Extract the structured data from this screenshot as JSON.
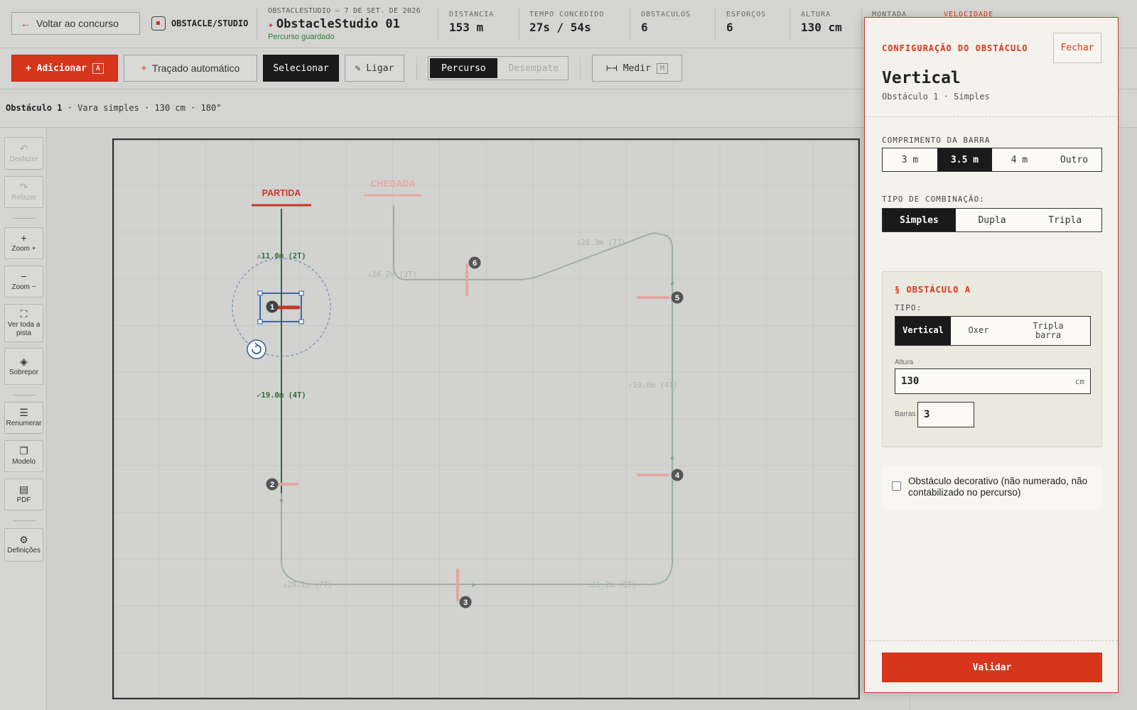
{
  "topbar": {
    "back_label": "Voltar ao concurso",
    "brand": "OBSTACLE/STUDIO",
    "doc_subtitle": "OBSTACLESTUDIO — 7 DE SET. DE 2026",
    "doc_title": "ObstacleStudio 01",
    "saved_status": "Percurso guardado",
    "stats": [
      {
        "label": "DISTANCIA",
        "value": "153 m"
      },
      {
        "label": "TEMPO CONCEDIDO",
        "value": "27s / 54s"
      },
      {
        "label": "OBSTACULOS",
        "value": "6"
      },
      {
        "label": "ESFORÇOS",
        "value": "6"
      },
      {
        "label": "ALTURA",
        "value": "130 cm"
      },
      {
        "label": "MONTADA",
        "value": ""
      },
      {
        "label": "VELOCIDADE",
        "value": ""
      }
    ]
  },
  "toolbar": {
    "add_label": "+ Adicionar",
    "add_key": "A",
    "auto_label": "Traçado automático",
    "select_label": "Selecionar",
    "link_label": "✎ Ligar",
    "mode_tabs": [
      "Percurso",
      "Desempate"
    ],
    "measure_label": "Medir",
    "measure_key": "M"
  },
  "inforow": {
    "obstacle": "Obstáculo 1",
    "details": " · Vara simples · 130 cm · 180°"
  },
  "sidebar": {
    "undo": "Desfazer",
    "redo": "Refazer",
    "zoom_in": "Zoom +",
    "zoom_out": "Zoom −",
    "fit": "Ver toda a pista",
    "overlay": "Sobrepor",
    "renumber": "Renumerar",
    "template": "Modelo",
    "pdf": "PDF",
    "settings": "Definições"
  },
  "course": {
    "start_label": "PARTIDA",
    "finish_label": "CHEGADA",
    "segments": [
      "⚠11.0m (2T)",
      "✓19.0m (4T)",
      "⚠28.2m (7T)",
      "⚠31.2m (8T)",
      "✓19.0m (4T)",
      "⚠28.3m (7T)",
      "⚠16.2m (3T)"
    ],
    "obstacle_numbers": [
      "1",
      "2",
      "3",
      "4",
      "5",
      "6"
    ]
  },
  "panel": {
    "kicker": "CONFIGURAÇÃO DO OBSTÁCULO",
    "close_label": "Fechar",
    "title": "Vertical",
    "subtitle": "Obstáculo 1 · Simples",
    "bar_length_label": "COMPRIMENTO DA BARRA",
    "bar_lengths": [
      "3 m",
      "3.5 m",
      "4 m",
      "Outro"
    ],
    "bar_length_selected": 1,
    "combination_label": "TIPO DE COMBINAÇÃO:",
    "combinations": [
      "Simples",
      "Dupla",
      "Tripla"
    ],
    "combination_selected": 0,
    "section_a_label": "§ OBSTÁCULO A",
    "type_label": "TIPO:",
    "types": [
      "Vertical",
      "Oxer",
      "Tripla barra"
    ],
    "type_selected": 0,
    "height_label": "Altura",
    "height_value": "130",
    "height_unit": "cm",
    "bars_label": "Barras",
    "bars_value": "3",
    "decorative_label": "Obstáculo decorativo (não numerado, não contabilizado no percurso)",
    "decorative_checked": false,
    "validate_label": "Validar"
  },
  "colors": {
    "accent": "#d6361c",
    "green_path": "#2e7d32",
    "selection": "#2a5d9f"
  }
}
